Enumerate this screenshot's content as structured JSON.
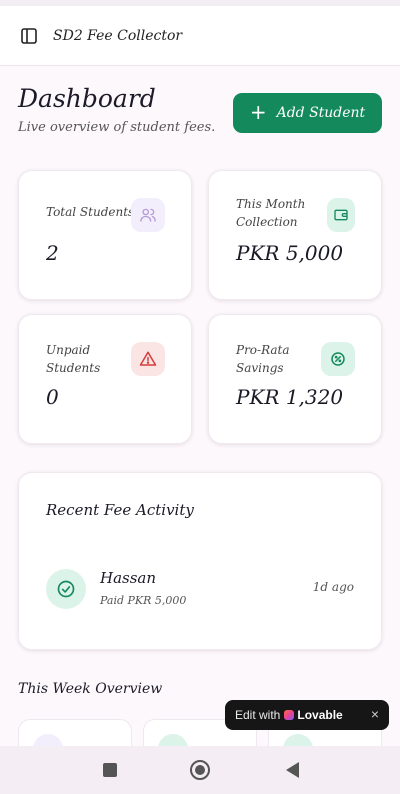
{
  "app": {
    "title": "SD2 Fee Collector"
  },
  "header": {
    "title": "Dashboard",
    "subtitle": "Live overview of student fees.",
    "add_button_label": "Add Student"
  },
  "stats": [
    {
      "label": "Total Students",
      "value": "2",
      "icon": "users-icon",
      "color": "#b49ad6"
    },
    {
      "label": "This Month Collection",
      "value": "PKR 5,000",
      "icon": "wallet-icon",
      "color": "#148a5c"
    },
    {
      "label": "Unpaid Students",
      "value": "0",
      "icon": "alert-triangle-icon",
      "color": "#d43c3c"
    },
    {
      "label": "Pro-Rata Savings",
      "value": "PKR 1,320",
      "icon": "percent-badge-icon",
      "color": "#148a5c"
    }
  ],
  "activity": {
    "title": "Recent Fee Activity",
    "items": [
      {
        "name": "Hassan",
        "detail": "Paid PKR 5,000",
        "time": "1d ago",
        "icon": "check-circle-icon"
      }
    ]
  },
  "week": {
    "title": "This Week Overview"
  },
  "lovable_badge": {
    "prefix": "Edit with",
    "brand": "Lovable",
    "close": "×"
  },
  "colors": {
    "accent": "#148a5c",
    "background": "#fdf8fc"
  },
  "system_nav": {
    "icons": [
      "square-icon",
      "home-circle-icon",
      "back-triangle-icon"
    ]
  }
}
